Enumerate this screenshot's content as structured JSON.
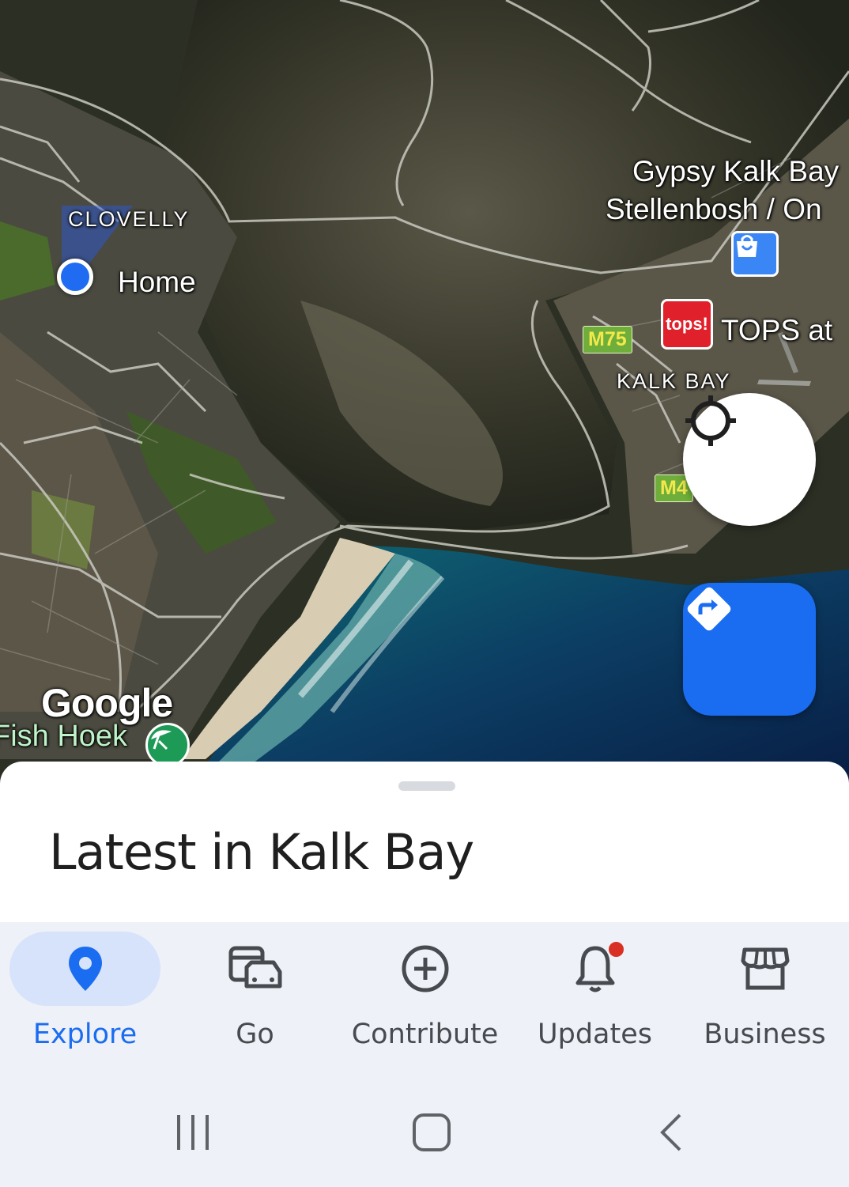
{
  "map": {
    "suburb_label": "CLOVELLY",
    "home_label": "Home",
    "place_label_line1": "Gypsy Kalk Bay",
    "place_label_line2": "Stellenbosh / On",
    "route_label_1": "M75",
    "route_label_2": "M4",
    "store_label": "TOPS at",
    "store_logo_text": "tops!",
    "area_label": "KALK BAY",
    "watermark": "Google",
    "town_label": "Fish Hoek",
    "icons": {
      "locate": "my-location-icon",
      "directions": "directions-icon",
      "shopping": "shopping-bag-icon",
      "beach": "beach-umbrella-icon"
    }
  },
  "sheet": {
    "title": "Latest in Kalk Bay"
  },
  "nav": {
    "items": [
      {
        "label": "Explore",
        "icon": "location-pin-icon",
        "active": true
      },
      {
        "label": "Go",
        "icon": "commute-icon",
        "active": false
      },
      {
        "label": "Contribute",
        "icon": "add-circle-icon",
        "active": false
      },
      {
        "label": "Updates",
        "icon": "bell-icon",
        "active": false,
        "badge": true
      },
      {
        "label": "Business",
        "icon": "storefront-icon",
        "active": false
      }
    ]
  },
  "system_nav": {
    "buttons": [
      "recents-icon",
      "home-icon",
      "back-icon"
    ]
  },
  "colors": {
    "accent": "#1a6df0",
    "active_pill": "#d7e3fb",
    "badge": "#d93025",
    "nav_background": "#eef1f7"
  }
}
